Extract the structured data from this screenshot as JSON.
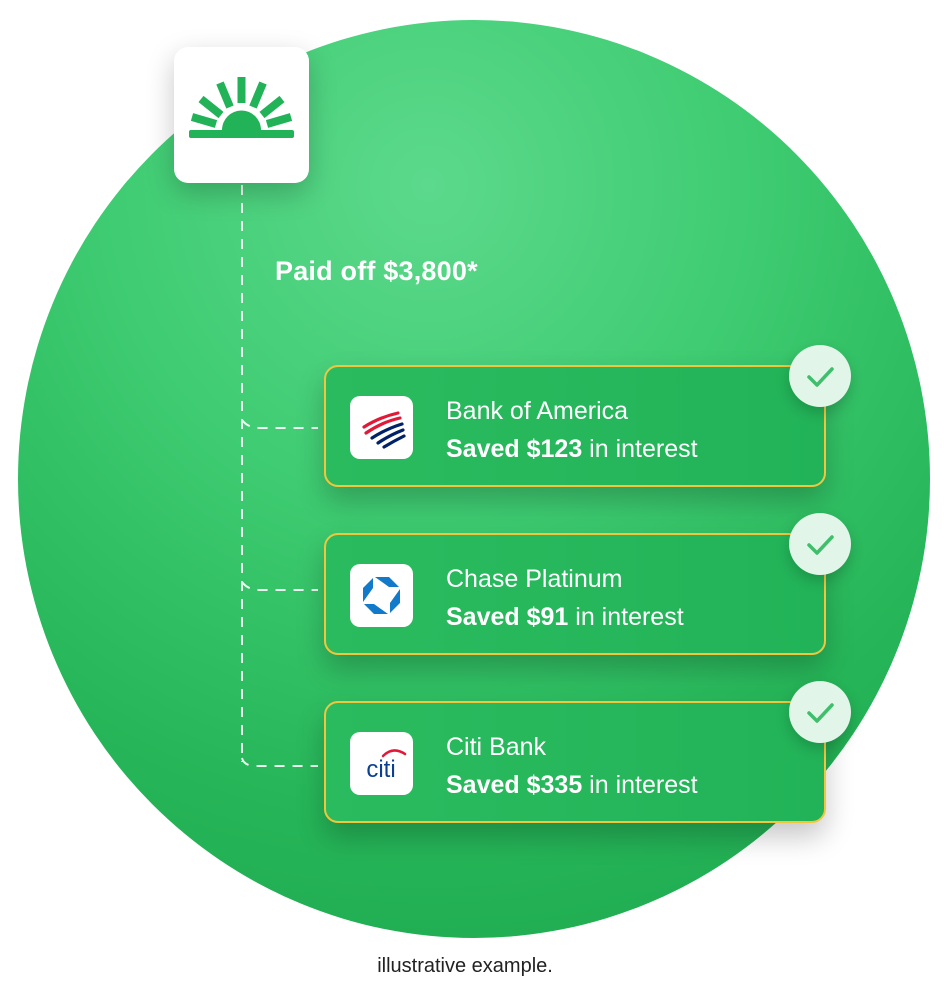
{
  "brand": {
    "logo_icon": "sunrise-icon",
    "accent": "#22b358"
  },
  "summary": {
    "paid_off": "Paid off $3,800*"
  },
  "accounts": [
    {
      "bank": "Bank of America",
      "saved": "Saved $123",
      "suffix": " in interest",
      "logo": "bank-of-america-logo",
      "checked": true
    },
    {
      "bank": "Chase Platinum",
      "saved": "Saved $91",
      "suffix": " in interest",
      "logo": "chase-logo",
      "checked": true
    },
    {
      "bank": "Citi Bank",
      "saved": "Saved $335",
      "suffix": " in interest",
      "logo": "citi-logo",
      "logo_text": "citi",
      "checked": true
    }
  ],
  "footnote": "illustrative example.",
  "colors": {
    "circle": "#3fcc72",
    "card_border": "#f0c63e",
    "check": "#3fbf6c"
  }
}
